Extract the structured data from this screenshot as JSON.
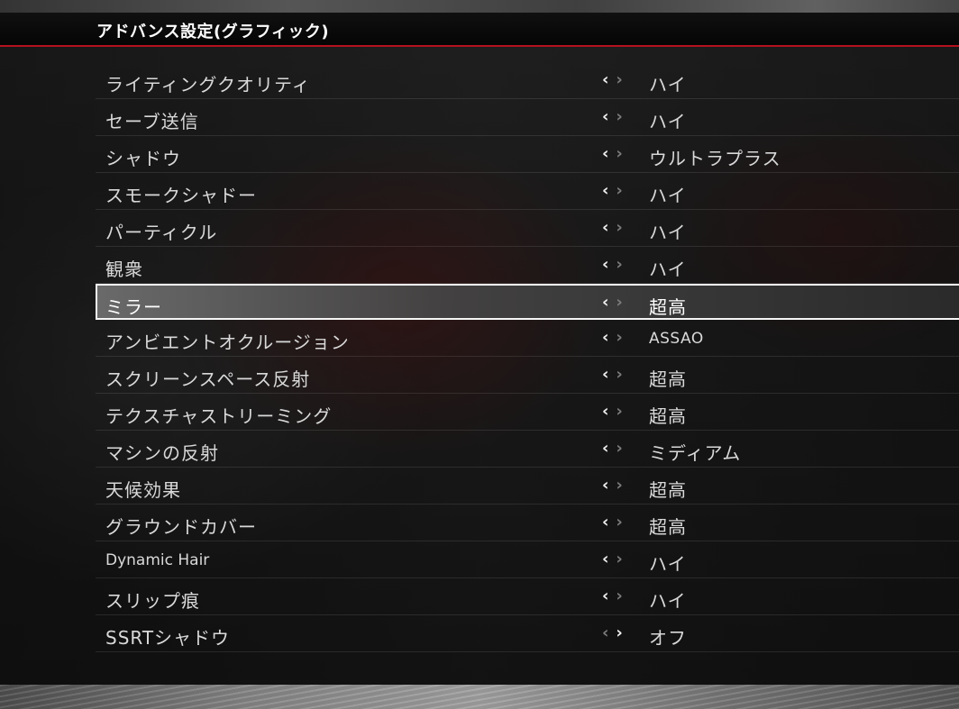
{
  "header": {
    "title": "アドバンス設定(グラフィック)"
  },
  "settings": [
    {
      "label": "ライティングクオリティ",
      "value": "ハイ",
      "left_active": true,
      "right_active": false
    },
    {
      "label": "セーブ送信",
      "value": "ハイ",
      "left_active": true,
      "right_active": false
    },
    {
      "label": "シャドウ",
      "value": "ウルトラプラス",
      "left_active": true,
      "right_active": false
    },
    {
      "label": "スモークシャドー",
      "value": "ハイ",
      "left_active": true,
      "right_active": false
    },
    {
      "label": "パーティクル",
      "value": "ハイ",
      "left_active": true,
      "right_active": false
    },
    {
      "label": "観衆",
      "value": "ハイ",
      "left_active": true,
      "right_active": false
    },
    {
      "label": "ミラー",
      "value": "超高",
      "left_active": true,
      "right_active": false,
      "selected": true
    },
    {
      "label": "アンビエントオクルージョン",
      "value": "ASSAO",
      "left_active": true,
      "right_active": false
    },
    {
      "label": "スクリーンスペース反射",
      "value": "超高",
      "left_active": true,
      "right_active": false
    },
    {
      "label": "テクスチャストリーミング",
      "value": "超高",
      "left_active": true,
      "right_active": false
    },
    {
      "label": "マシンの反射",
      "value": "ミディアム",
      "left_active": true,
      "right_active": false
    },
    {
      "label": "天候効果",
      "value": "超高",
      "left_active": true,
      "right_active": false
    },
    {
      "label": "グラウンドカバー",
      "value": "超高",
      "left_active": true,
      "right_active": false
    },
    {
      "label": "Dynamic Hair",
      "value": "ハイ",
      "left_active": true,
      "right_active": false
    },
    {
      "label": "スリップ痕",
      "value": "ハイ",
      "left_active": true,
      "right_active": false
    },
    {
      "label": "SSRTシャドウ",
      "value": "オフ",
      "left_active": false,
      "right_active": true
    }
  ],
  "arrow_left_glyph": "‹",
  "arrow_right_glyph": "›",
  "colors": {
    "accent_line": "#b3121e",
    "text": "#d9d9d9",
    "selected_border": "#f5f5f5"
  }
}
